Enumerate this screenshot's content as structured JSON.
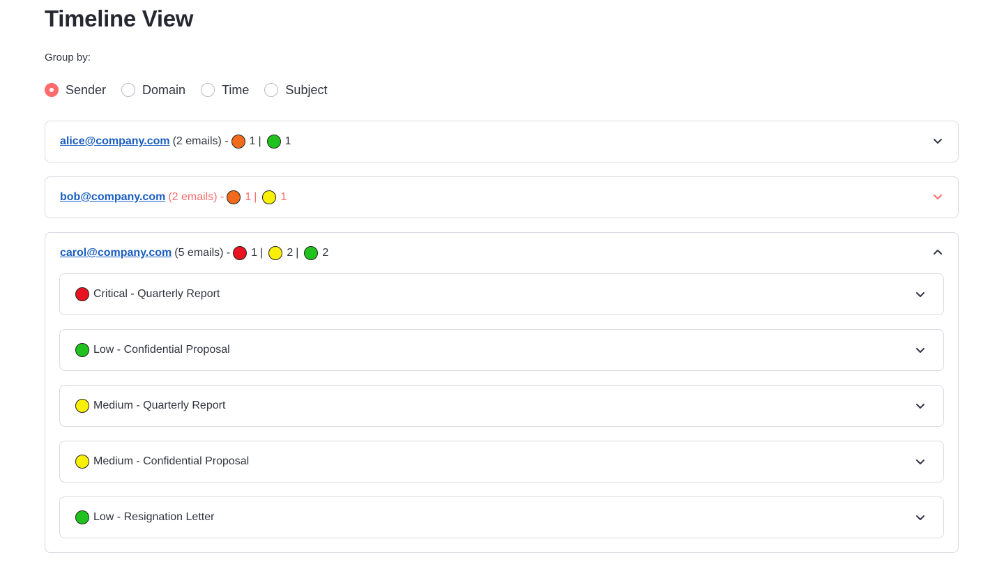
{
  "page": {
    "title": "Timeline View",
    "group_by_label": "Group by:"
  },
  "group_by": {
    "selected": "Sender",
    "options": [
      "Sender",
      "Domain",
      "Time",
      "Subject"
    ]
  },
  "senders": [
    {
      "email": "alice@company.com",
      "summary": "(2 emails) -",
      "counts": [
        {
          "severity": "orange",
          "count": "1"
        },
        {
          "severity": "green",
          "count": "1"
        }
      ],
      "expanded": false,
      "highlight": false
    },
    {
      "email": "bob@company.com",
      "summary": "(2 emails) -",
      "counts": [
        {
          "severity": "orange",
          "count": "1"
        },
        {
          "severity": "yellow",
          "count": "1"
        }
      ],
      "expanded": false,
      "highlight": true
    },
    {
      "email": "carol@company.com",
      "summary": "(5 emails) -",
      "counts": [
        {
          "severity": "red",
          "count": "1"
        },
        {
          "severity": "yellow",
          "count": "2"
        },
        {
          "severity": "green",
          "count": "2"
        }
      ],
      "expanded": true,
      "highlight": false,
      "emails": [
        {
          "severity": "red",
          "label": "Critical - Quarterly Report"
        },
        {
          "severity": "green",
          "label": "Low - Confidential Proposal"
        },
        {
          "severity": "yellow",
          "label": "Medium - Quarterly Report"
        },
        {
          "severity": "yellow",
          "label": "Medium - Confidential Proposal"
        },
        {
          "severity": "green",
          "label": "Low - Resignation Letter"
        }
      ]
    }
  ],
  "separator": "|",
  "colors": {
    "accent": "#ff6c6c",
    "link": "#1a5ebf",
    "severity_red": "#e8131f",
    "severity_orange": "#f26a1b",
    "severity_yellow": "#f9ef07",
    "severity_green": "#20c31d"
  }
}
